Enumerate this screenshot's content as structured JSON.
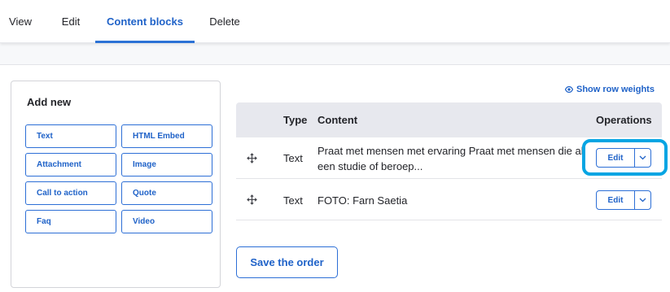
{
  "tabs": [
    {
      "label": "View",
      "active": false
    },
    {
      "label": "Edit",
      "active": false
    },
    {
      "label": "Content blocks",
      "active": true
    },
    {
      "label": "Delete",
      "active": false
    }
  ],
  "add_new": {
    "title": "Add new",
    "buttons": [
      "Text",
      "HTML Embed",
      "Attachment",
      "Image",
      "Call to action",
      "Quote",
      "Faq",
      "Video"
    ]
  },
  "show_row_weights": "Show row weights",
  "table": {
    "headers": {
      "type": "Type",
      "content": "Content",
      "operations": "Operations"
    },
    "rows": [
      {
        "type": "Text",
        "content": "Praat met mensen met ervaring Praat met mensen die al een studie of beroep...",
        "operation": "Edit"
      },
      {
        "type": "Text",
        "content": "FOTO: Farn Saetia",
        "operation": "Edit"
      }
    ]
  },
  "save_order": "Save the order",
  "colors": {
    "accent": "#1f62c8",
    "highlight": "#07a5e3",
    "header_bg": "#e7e8ee"
  },
  "icons": {
    "row_weights": "eye-icon",
    "drag": "drag-handle-icon",
    "dropdown": "chevron-down-icon"
  }
}
